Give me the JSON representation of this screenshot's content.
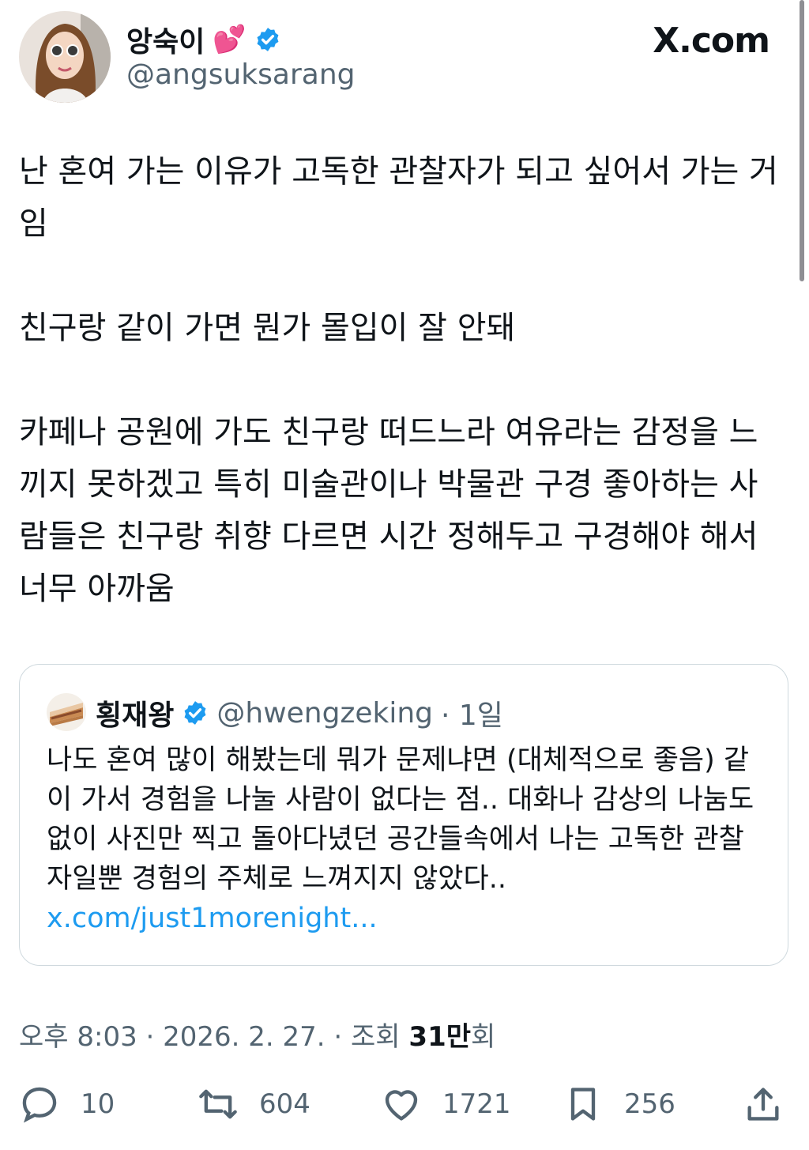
{
  "author": {
    "display_name": "앙숙이",
    "handle": "@angsuksarang",
    "verified": true
  },
  "brand": {
    "logo_text": "X.com"
  },
  "tweet": {
    "paragraphs": [
      "난 혼여 가는 이유가 고독한 관찰자가 되고 싶어서 가는 거임",
      "친구랑 같이 가면 뭔가 몰입이 잘 안돼",
      "카페나 공원에 가도 친구랑 떠드느라 여유라는 감정을 느끼지 못하겠고 특히 미술관이나 박물관 구경 좋아하는 사람들은 친구랑 취향 다르면 시간 정해두고 구경해야 해서 너무 아까움"
    ]
  },
  "quote": {
    "display_name": "횡재왕",
    "handle": "@hwengzeking",
    "time": "· 1일",
    "text": "나도 혼여 많이 해봤는데 뭐가 문제냐면 (대체적으로 좋음) 같이 가서 경험을 나눌 사람이 없다는 점.. 대화나 감상의 나눔도 없이 사진만 찍고 돌아다녔던 공간들속에서 나는 고독한 관찰자일뿐 경험의 주체로 느껴지지 않았다.. ",
    "link": "x.com/just1morenight..."
  },
  "meta": {
    "timestamp": "오후 8:03 · 2026. 2. 27. · 조회 ",
    "views": "31만",
    "views_suffix": "회"
  },
  "actions": {
    "replies": "10",
    "reposts": "604",
    "likes": "1721",
    "bookmarks": "256"
  },
  "colors": {
    "accent": "#1d9bf0",
    "secondary_text": "#536471",
    "heart_emoji": "#e3348d"
  }
}
